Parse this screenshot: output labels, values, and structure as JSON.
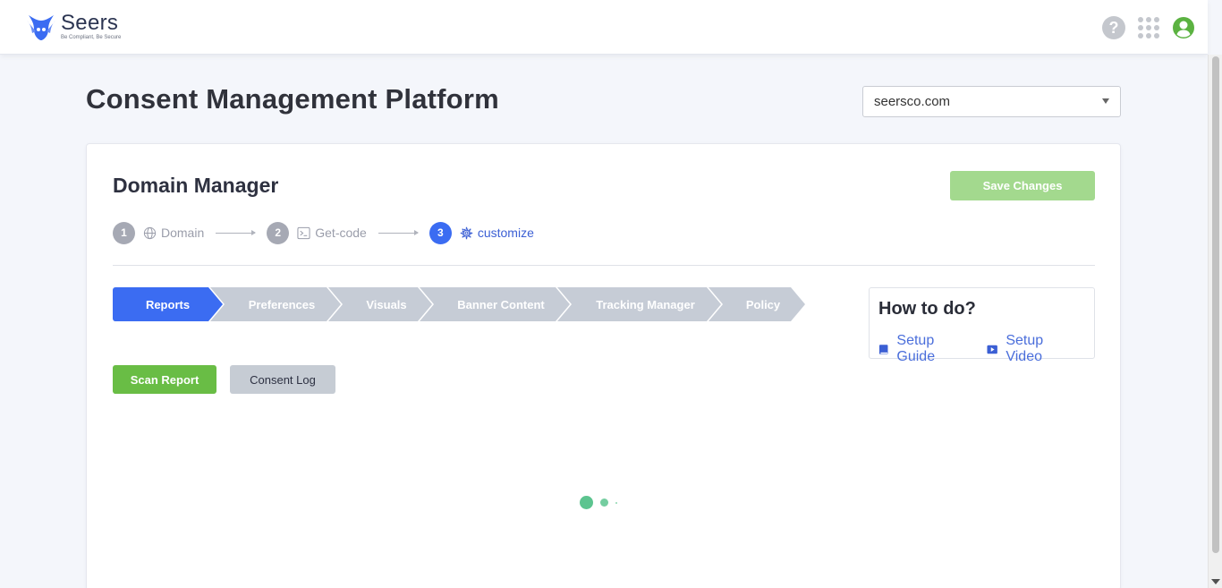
{
  "app": {
    "brand_name": "Seers",
    "brand_tagline": "Be Compliant, Be Secure"
  },
  "header": {
    "icons": [
      "help-icon",
      "apps-grid-icon",
      "user-account-icon"
    ]
  },
  "page": {
    "title": "Consent Management Platform",
    "domain_select": {
      "value": "seersco.com"
    }
  },
  "card": {
    "title": "Domain Manager",
    "save_label": "Save Changes",
    "steps": [
      {
        "number": "1",
        "label": "Domain",
        "icon": "globe-icon",
        "active": false
      },
      {
        "number": "2",
        "label": "Get-code",
        "icon": "terminal-icon",
        "active": false
      },
      {
        "number": "3",
        "label": "customize",
        "icon": "gear-icon",
        "active": true
      }
    ],
    "tabs": [
      {
        "label": "Reports",
        "active": true
      },
      {
        "label": "Preferences",
        "active": false
      },
      {
        "label": "Visuals",
        "active": false
      },
      {
        "label": "Banner Content",
        "active": false
      },
      {
        "label": "Tracking Manager",
        "active": false
      },
      {
        "label": "Policy",
        "active": false
      }
    ],
    "actions": {
      "scan_report": "Scan Report",
      "consent_log": "Consent Log"
    },
    "howto": {
      "title": "How to do?",
      "guide_label": "Setup Guide",
      "video_label": "Setup Video"
    }
  },
  "colors": {
    "primary": "#3b6cf2",
    "success": "#69bd45",
    "save_disabled": "#a3d98e",
    "loader": "#5cc48f"
  }
}
